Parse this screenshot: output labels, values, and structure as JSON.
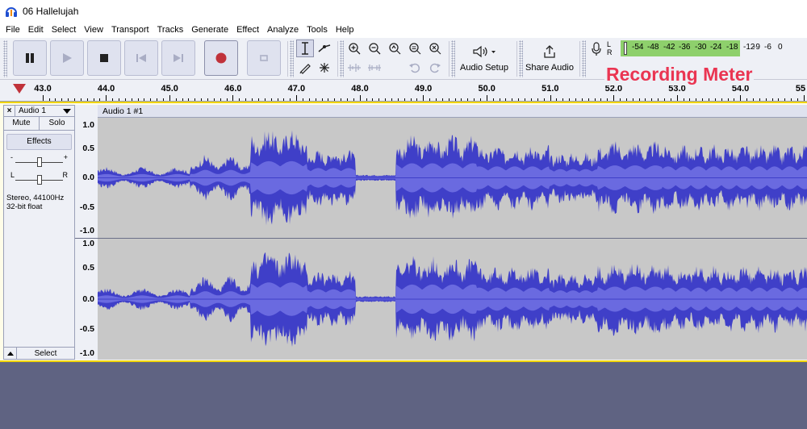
{
  "window": {
    "title": "06 Hallelujah",
    "accent": "#4a4ad4"
  },
  "menu": [
    "File",
    "Edit",
    "Select",
    "View",
    "Transport",
    "Tracks",
    "Generate",
    "Effect",
    "Analyze",
    "Tools",
    "Help"
  ],
  "toolbar": {
    "audio_setup": "Audio Setup",
    "share_audio": "Share Audio"
  },
  "meter": {
    "left": "L",
    "right": "R",
    "scale": [
      "-54",
      "-48",
      "-42",
      "-36",
      "-30",
      "-24",
      "-18",
      "-12",
      "-9",
      "-6",
      "0"
    ]
  },
  "ruler": {
    "labels": [
      "43.0",
      "44.0",
      "45.0",
      "46.0",
      "47.0",
      "48.0",
      "49.0",
      "50.0",
      "51.0",
      "52.0",
      "53.0",
      "54.0",
      "55"
    ]
  },
  "callout": "Recording Meter",
  "track": {
    "name": "Audio 1",
    "mute": "Mute",
    "solo": "Solo",
    "effects": "Effects",
    "gain_minus": "-",
    "gain_plus": "+",
    "pan_left": "L",
    "pan_right": "R",
    "info_line1": "Stereo, 44100Hz",
    "info_line2": "32-bit float",
    "select": "Select",
    "clip_name": "Audio 1 #1",
    "scale": [
      "1.0",
      "0.5",
      "0.0",
      "-0.5",
      "-1.0"
    ],
    "wave_color": "#3f3fc8"
  }
}
